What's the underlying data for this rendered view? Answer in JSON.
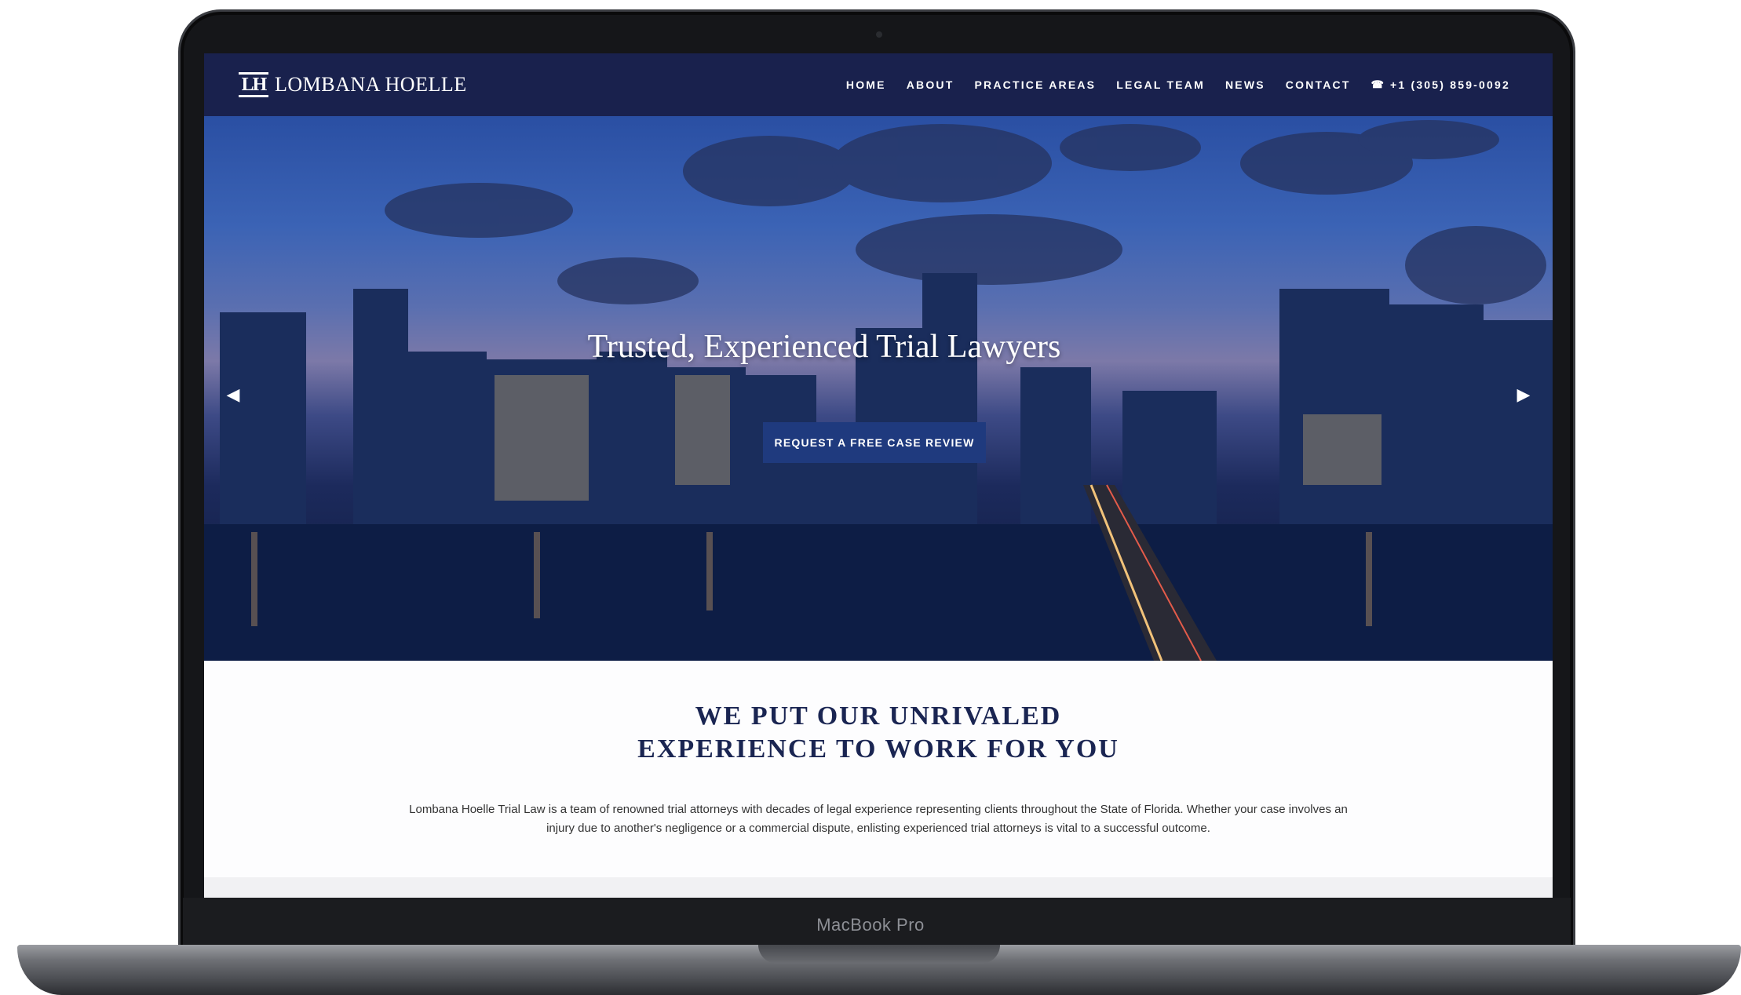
{
  "device": {
    "label": "MacBook Pro"
  },
  "header": {
    "logo_mark": "LH",
    "logo_text": "LOMBANA HOELLE",
    "nav": [
      {
        "label": "HOME"
      },
      {
        "label": "ABOUT"
      },
      {
        "label": "PRACTICE AREAS"
      },
      {
        "label": "LEGAL TEAM"
      },
      {
        "label": "NEWS"
      },
      {
        "label": "CONTACT"
      }
    ],
    "phone": "+1 (305) 859-0092",
    "colors": {
      "bar": "#19214d"
    }
  },
  "hero": {
    "title": "Trusted, Experienced  Trial Lawyers",
    "cta": "REQUEST A FREE CASE REVIEW",
    "prev_icon": "chevron-left-icon",
    "next_icon": "chevron-right-icon"
  },
  "intro": {
    "title_line1": "WE PUT OUR UNRIVALED",
    "title_line2": "EXPERIENCE TO WORK FOR YOU",
    "body_line1": "Lombana Hoelle Trial Law is a team of renowned trial attorneys with decades of legal experience representing clients throughout the State of Florida. Whether your case involves an",
    "body_line2": "injury due to another's negligence or a commercial dispute, enlisting experienced trial attorneys is vital to a successful outcome."
  }
}
